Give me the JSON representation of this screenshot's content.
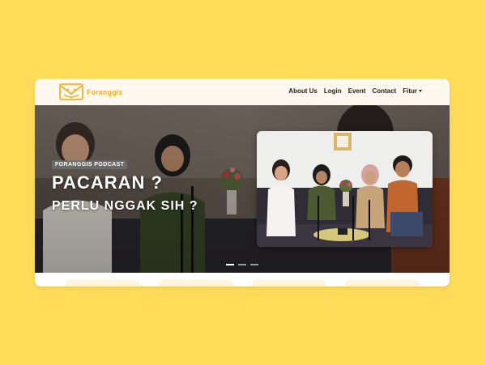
{
  "brand": {
    "name": "Foranggis",
    "logo": "envelope-logo-icon",
    "color": "#F3B12B"
  },
  "nav": {
    "items": [
      {
        "label": "About Us"
      },
      {
        "label": "Login"
      },
      {
        "label": "Event"
      },
      {
        "label": "Contact"
      },
      {
        "label": "Fitur",
        "dropdown": true
      }
    ]
  },
  "hero": {
    "badge": "FORANGGIS PODCAST",
    "headline1": "PACARAN ?",
    "headline2": "PERLU NGGAK SIH ?",
    "slides": {
      "count": 3,
      "active": 1
    }
  },
  "theme": {
    "page_bg": "#FFDB5A",
    "navbar_bg": "#FFF8EE"
  }
}
